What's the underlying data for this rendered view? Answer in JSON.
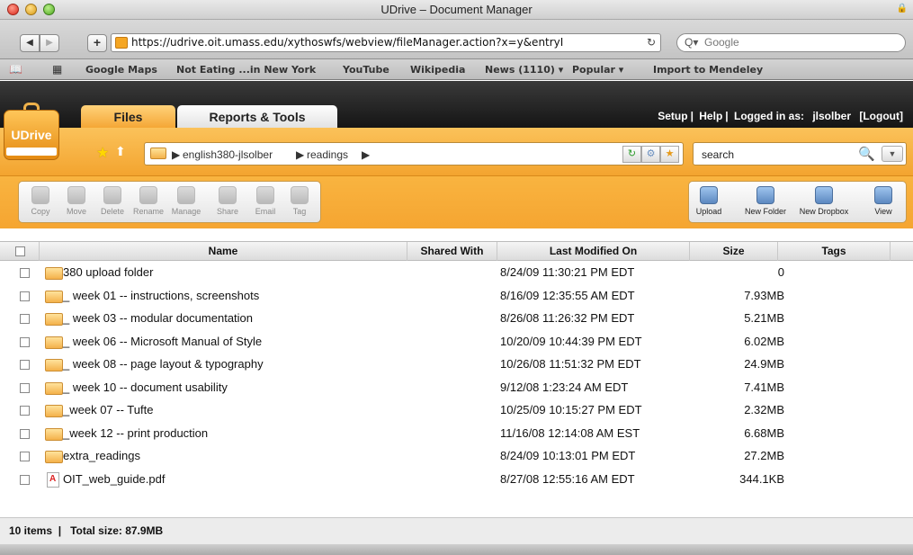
{
  "window": {
    "title": "UDrive – Document Manager"
  },
  "browser": {
    "url": "https://udrive.oit.umass.edu/xythoswfs/webview/fileManager.action?x=y&entryI",
    "search_placeholder": "Google",
    "bookmarks": [
      "Google Maps",
      "Not Eating ...in New York",
      "YouTube",
      "Wikipedia",
      "News (1110) ▾",
      "Popular ▾",
      "Import to Mendeley"
    ]
  },
  "app": {
    "logo_text": "UDrive",
    "tabs": [
      "Files",
      "Reports & Tools"
    ],
    "header": {
      "setup": "Setup",
      "help": "Help",
      "logged_in_label": "Logged in as:",
      "username": "jlsolber",
      "logout": "[Logout]"
    },
    "path": [
      "english380-jlsolber",
      "readings"
    ],
    "search_value": "search",
    "actions_left": [
      "Copy",
      "Move",
      "Delete",
      "Rename",
      "Manage",
      "Share",
      "Email",
      "Tag"
    ],
    "actions_right": [
      "Upload",
      "New Folder",
      "New Dropbox",
      "View"
    ],
    "columns": [
      "Name",
      "Shared With",
      "Last Modified On",
      "Size",
      "Tags"
    ],
    "files": [
      {
        "name": "380 upload folder",
        "type": "folder",
        "modified": "8/24/09 11:30:21 PM EDT",
        "size": "0"
      },
      {
        "name": "_ week 01 -- instructions, screenshots",
        "type": "folder",
        "modified": "8/16/09 12:35:55 AM EDT",
        "size": "7.93MB"
      },
      {
        "name": "_ week 03 -- modular documentation",
        "type": "folder",
        "modified": "8/26/08 11:26:32 PM EDT",
        "size": "5.21MB"
      },
      {
        "name": "_ week 06 -- Microsoft Manual of Style",
        "type": "folder",
        "modified": "10/20/09 10:44:39 PM EDT",
        "size": "6.02MB"
      },
      {
        "name": "_ week 08 -- page layout & typography",
        "type": "folder",
        "modified": "10/26/08 11:51:32 PM EDT",
        "size": "24.9MB"
      },
      {
        "name": "_ week 10 -- document usability",
        "type": "folder",
        "modified": "9/12/08 1:23:24 AM EDT",
        "size": "7.41MB"
      },
      {
        "name": "_week 07 -- Tufte",
        "type": "folder",
        "modified": "10/25/09 10:15:27 PM EDT",
        "size": "2.32MB"
      },
      {
        "name": "_week 12 -- print production",
        "type": "folder",
        "modified": "11/16/08 12:14:08 AM EST",
        "size": "6.68MB"
      },
      {
        "name": "extra_readings",
        "type": "folder",
        "modified": "8/24/09 10:13:01 PM EDT",
        "size": "27.2MB"
      },
      {
        "name": "OIT_web_guide.pdf",
        "type": "pdf",
        "modified": "8/27/08 12:55:16 AM EDT",
        "size": "344.1KB"
      }
    ],
    "footer": {
      "items": "10 items",
      "total": "Total size: 87.9MB"
    }
  }
}
